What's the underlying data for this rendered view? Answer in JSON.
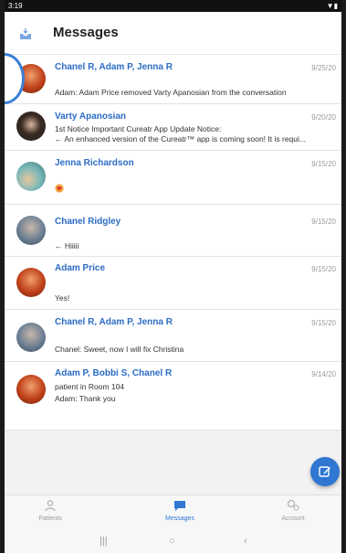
{
  "status_bar": {
    "time": "3:19",
    "indicators": "▼▮"
  },
  "header": {
    "title": "Messages",
    "icon": "inbox-icon"
  },
  "conversations": [
    {
      "name": "Chanel R, Adam P, Jenna R",
      "date": "9/25/20",
      "lines": [
        "",
        "Adam: Adam Price removed Varty Apanosian from the conversation"
      ]
    },
    {
      "name": "Varty Apanosian",
      "date": "9/20/20",
      "lines": [
        "1st Notice Important Cureatr App Update Notice:",
        "← An enhanced version of the Cureatr™ app is coming soon! It is requi..."
      ]
    },
    {
      "name": "Jenna Richardson",
      "date": "9/15/20",
      "lines": [
        "",
        ""
      ]
    },
    {
      "name": "Chanel Ridgley",
      "date": "9/15/20",
      "lines": [
        "",
        "← Hiiiii"
      ]
    },
    {
      "name": "Adam Price",
      "date": "9/15/20",
      "lines": [
        "",
        "Yes!"
      ]
    },
    {
      "name": "Chanel R, Adam P, Jenna R",
      "date": "9/15/20",
      "lines": [
        "",
        "Chanel: Sweet, now I will fix Christina"
      ]
    },
    {
      "name": "Adam P, Bobbi S, Chanel R",
      "date": "9/14/20",
      "lines": [
        "patient in Room 104",
        "Adam: Thank you"
      ]
    }
  ],
  "bottom_nav": [
    {
      "label": "Patients",
      "icon": "patients-icon"
    },
    {
      "label": "Messages",
      "icon": "messages-icon"
    },
    {
      "label": "Account",
      "icon": "account-icon"
    }
  ],
  "colors": {
    "accent": "#2f77d1",
    "name_blue": "#2b6cc4"
  }
}
